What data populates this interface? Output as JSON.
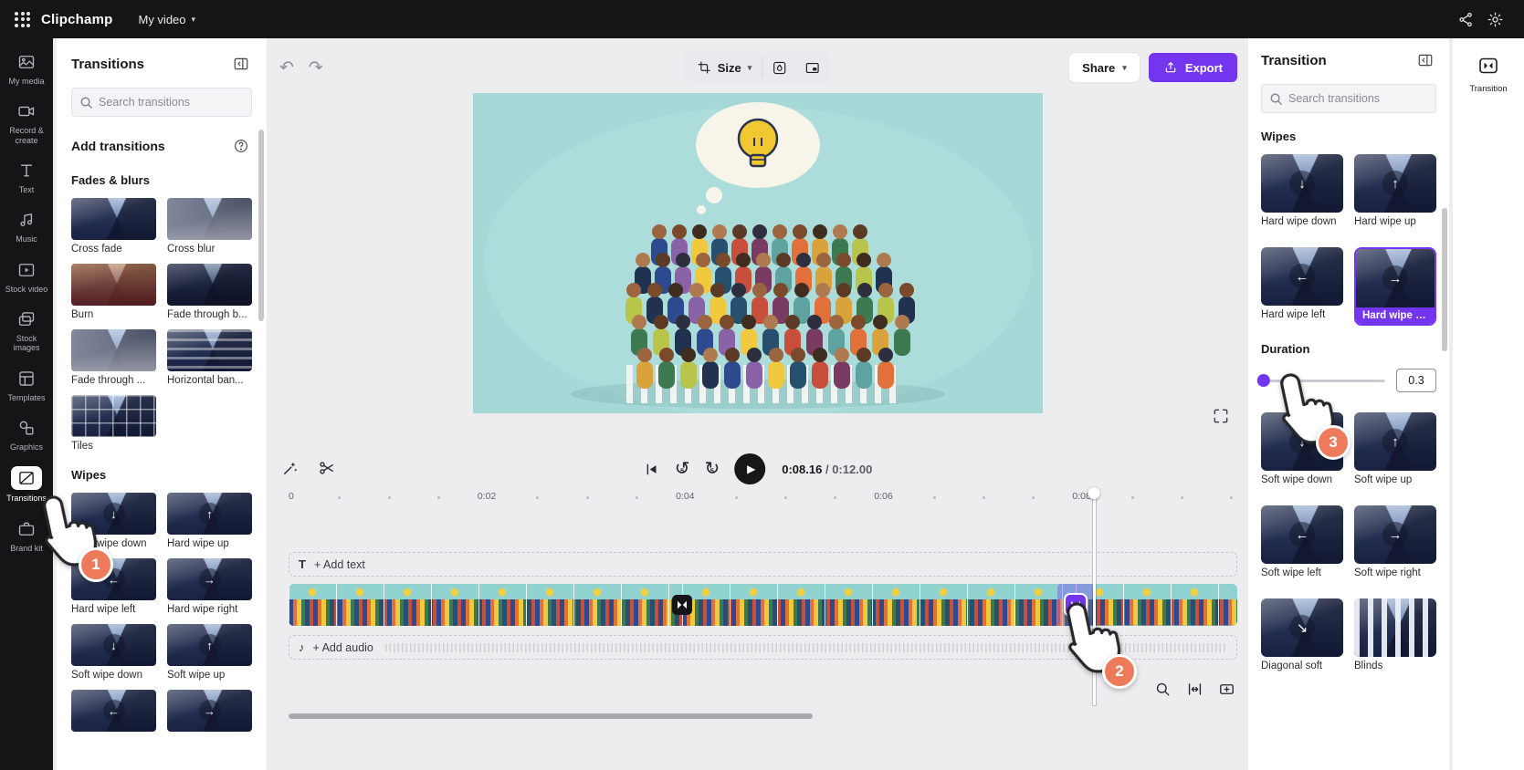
{
  "colors": {
    "accent_purple": "#7435f0",
    "badge_orange": "#ed7a5b",
    "topbar_bg": "#151517",
    "preview_teal": "#a5d8d6",
    "selected_transition": "#7435f0"
  },
  "icons": {
    "text_tool": "T",
    "music_note": "♪",
    "play": "▶",
    "undo": "↶",
    "redo": "↷",
    "replay_5": "↺",
    "forward_5": "↻",
    "skip_number": "5",
    "chevron_down": "▾",
    "arrow_down": "↓",
    "arrow_up": "↑",
    "arrow_left": "←",
    "arrow_right": "→",
    "arrow_down_right": "↘"
  },
  "topbar": {
    "app_name": "Clipchamp",
    "project_name": "My video"
  },
  "sidebar": {
    "active_item": "Transitions",
    "items": [
      {
        "label": "My media"
      },
      {
        "label": "Record & create"
      },
      {
        "label": "Text"
      },
      {
        "label": "Music"
      },
      {
        "label": "Stock video"
      },
      {
        "label": "Stock images"
      },
      {
        "label": "Templates"
      },
      {
        "label": "Graphics"
      },
      {
        "label": "Transitions",
        "active": true
      },
      {
        "label": "Brand kit"
      }
    ]
  },
  "left_panel": {
    "title": "Transitions",
    "search_placeholder": "Search transitions",
    "add_header": "Add transitions",
    "fades_title": "Fades & blurs",
    "fades_items": [
      "Cross fade",
      "Cross blur",
      "Burn",
      "Fade through b...",
      "Fade through ...",
      "Horizontal ban...",
      "Tiles"
    ],
    "wipes_title": "Wipes",
    "wipes_items": [
      "Hard wipe down",
      "Hard wipe up",
      "Hard wipe left",
      "Hard wipe right",
      "Soft wipe down",
      "Soft wipe up"
    ]
  },
  "toolbar": {
    "size_label": "Size",
    "share_label": "Share",
    "export_label": "Export"
  },
  "player": {
    "current_time": "0:08.16",
    "separator": "/",
    "total_time": "0:12.00"
  },
  "timeline": {
    "ticks": [
      "0",
      "0:02",
      "0:04",
      "0:06",
      "0:08"
    ],
    "add_text_label": "+ Add text",
    "add_audio_label": "+ Add audio"
  },
  "right_panel": {
    "title": "Transition",
    "search_placeholder": "Search transitions",
    "group_title": "Wipes",
    "items": [
      {
        "label": "Hard wipe down",
        "direction": "down"
      },
      {
        "label": "Hard wipe up",
        "direction": "up"
      },
      {
        "label": "Hard wipe left",
        "direction": "left"
      },
      {
        "label": "Hard wipe right",
        "direction": "right",
        "selected": true
      },
      {
        "label": "Soft wipe down",
        "direction": "down"
      },
      {
        "label": "Soft wipe up",
        "direction": "up"
      },
      {
        "label": "Soft wipe left",
        "direction": "left"
      },
      {
        "label": "Soft wipe right",
        "direction": "right"
      },
      {
        "label": "Diagonal soft",
        "direction": "down-right"
      },
      {
        "label": "Blinds",
        "direction": "none"
      }
    ],
    "duration_label": "Duration",
    "duration_value": "0.3"
  },
  "right_rail": {
    "tab_label": "Transition"
  },
  "annotations": {
    "steps": [
      "1",
      "2",
      "3"
    ]
  }
}
